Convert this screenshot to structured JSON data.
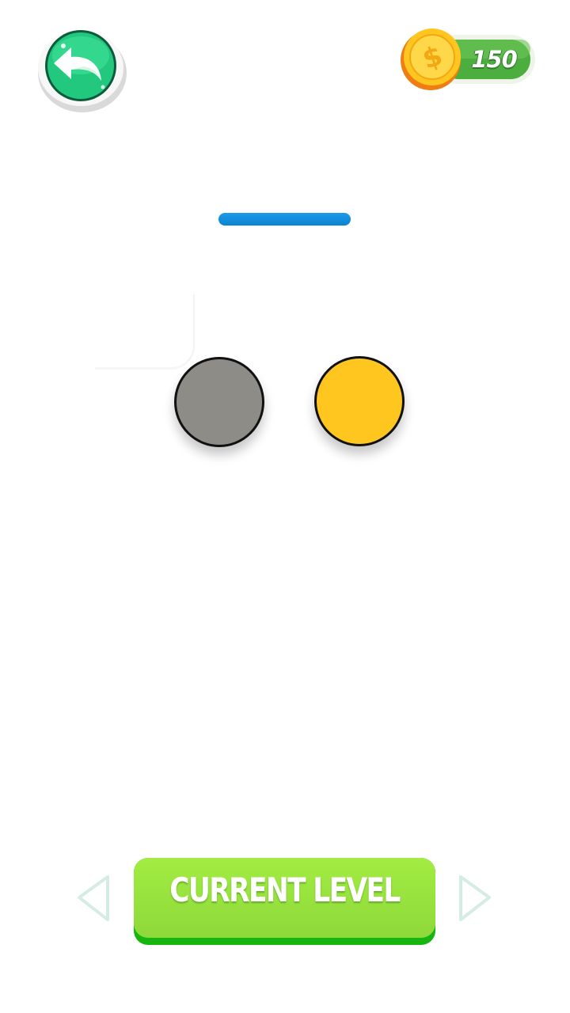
{
  "header": {
    "back_icon": "back-arrow-icon",
    "coin_icon": "dollar-coin-icon",
    "coin_count": "150"
  },
  "game": {
    "balls": [
      {
        "name": "gray-ball",
        "color": "#8e8c86"
      },
      {
        "name": "yellow-ball",
        "color": "#ffc61f"
      }
    ],
    "platform_color": "#0b8fe0"
  },
  "footer": {
    "level_button_label": "CURRENT LEVEL",
    "prev_icon": "triangle-left-icon",
    "next_icon": "triangle-right-icon"
  },
  "colors": {
    "accent_green": "#9ae63f",
    "button_shadow": "#16b50f",
    "coin_gold": "#ffc61f"
  }
}
